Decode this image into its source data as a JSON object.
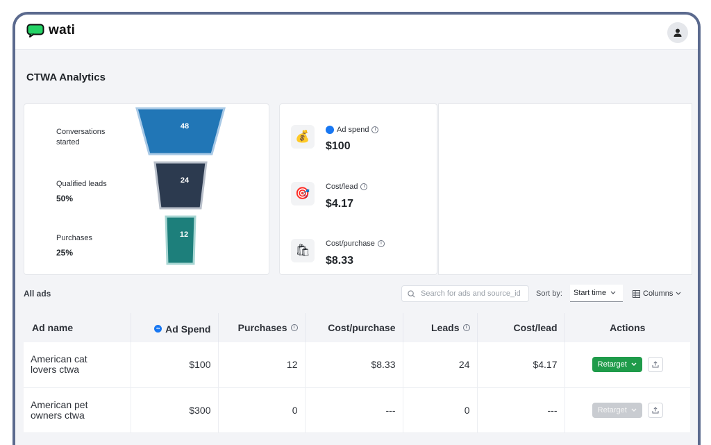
{
  "app": {
    "logo_text": "wati"
  },
  "page": {
    "title": "CTWA Analytics"
  },
  "funnel": {
    "stages": [
      {
        "label_line1": "Conversations",
        "label_line2": "started",
        "percent": "",
        "value": "48",
        "color": "#2176b6"
      },
      {
        "label_line1": "Qualified leads",
        "label_line2": "",
        "percent": "50%",
        "value": "24",
        "color": "#2c3a4f"
      },
      {
        "label_line1": "Purchases",
        "label_line2": "",
        "percent": "25%",
        "value": "12",
        "color": "#1d7f7b"
      }
    ]
  },
  "metrics": [
    {
      "icon": "money-bag-icon",
      "glyph": "💰",
      "label": "Ad spend",
      "value": "$100"
    },
    {
      "icon": "target-icon",
      "glyph": "🎯",
      "label": "Cost/lead",
      "value": "$4.17"
    },
    {
      "icon": "shopping-bag-icon",
      "glyph": "🛍",
      "label": "Cost/purchase",
      "value": "$8.33"
    }
  ],
  "ads_section": {
    "title": "All ads",
    "search_placeholder": "Search for ads and source_id",
    "sort_label": "Sort by:",
    "sort_value": "Start time",
    "columns_label": "Columns"
  },
  "table": {
    "headers": {
      "ad_name": "Ad name",
      "ad_spend": "Ad Spend",
      "purchases": "Purchases",
      "cost_purchase": "Cost/purchase",
      "leads": "Leads",
      "cost_lead": "Cost/lead",
      "actions": "Actions"
    },
    "rows": [
      {
        "name_line1": "American cat",
        "name_line2": "lovers ctwa",
        "spend": "$100",
        "purchases": "12",
        "cost_purchase": "$8.33",
        "leads": "24",
        "cost_lead": "$4.17",
        "action": "Retarget",
        "enabled": true
      },
      {
        "name_line1": "American pet",
        "name_line2": "owners ctwa",
        "spend": "$300",
        "purchases": "0",
        "cost_purchase": "---",
        "leads": "0",
        "cost_lead": "---",
        "action": "Retarget",
        "enabled": false
      }
    ]
  },
  "colors": {
    "brand_green": "#1f9b4a",
    "meta_blue": "#1877f2",
    "frame": "#5b6a8e"
  }
}
